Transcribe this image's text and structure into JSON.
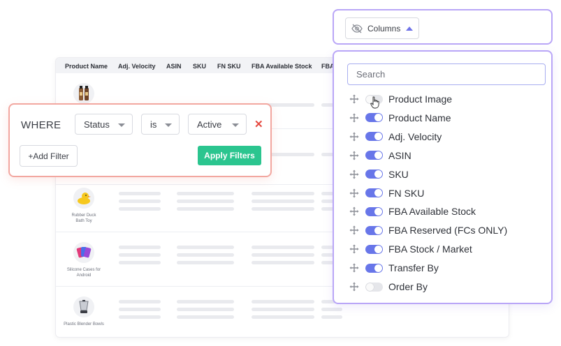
{
  "table": {
    "headers": [
      "Product Name",
      "Adj. Velocity",
      "ASIN",
      "SKU",
      "FN SKU",
      "FBA Available Stock",
      "FBA"
    ],
    "rows": [
      {
        "name": "",
        "icon": "bottle-icon"
      },
      {
        "name": "",
        "icon": "blank"
      },
      {
        "name": "Rubber Duck Bath Toy",
        "icon": "rubber-duck-icon"
      },
      {
        "name": "Silicone Cases for Android",
        "icon": "phone-cases-icon"
      },
      {
        "name": "Plastic Blender Bowls",
        "icon": "blender-icon"
      }
    ]
  },
  "columns": {
    "button_label": "Columns",
    "search_placeholder": "Search",
    "items": [
      {
        "label": "Product Image",
        "enabled": false
      },
      {
        "label": "Product Name",
        "enabled": true
      },
      {
        "label": "Adj. Velocity",
        "enabled": true
      },
      {
        "label": "ASIN",
        "enabled": true
      },
      {
        "label": "SKU",
        "enabled": true
      },
      {
        "label": "FN SKU",
        "enabled": true
      },
      {
        "label": "FBA Available Stock",
        "enabled": true
      },
      {
        "label": "FBA Reserved (FCs ONLY)",
        "enabled": true
      },
      {
        "label": "FBA Stock / Market",
        "enabled": true
      },
      {
        "label": "Transfer By",
        "enabled": true
      },
      {
        "label": "Order By",
        "enabled": false
      }
    ]
  },
  "filter": {
    "where_label": "WHERE",
    "field": "Status",
    "operator": "is",
    "value": "Active",
    "remove_symbol": "✕",
    "add_label": "+Add Filter",
    "apply_label": "Apply Filters"
  },
  "colors": {
    "accent": "#6876e9",
    "panel_border": "#b9a6f7",
    "filter_border": "#f2a7a0",
    "apply_green": "#2bc58f",
    "remove_red": "#e5483f"
  }
}
